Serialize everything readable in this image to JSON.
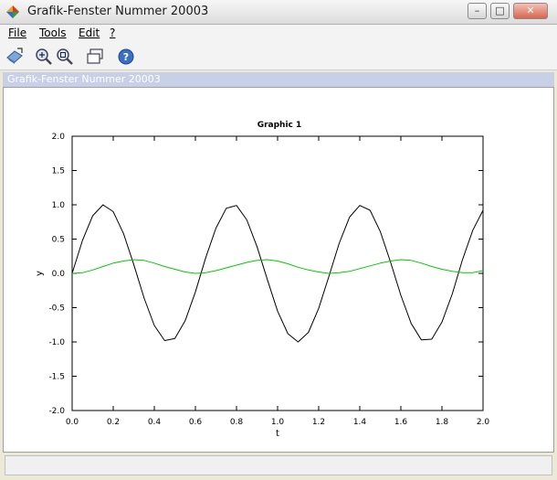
{
  "window": {
    "title": "Grafik-Fenster Nummer 20003",
    "controls": {
      "minimize": "–",
      "maximize": "□",
      "close": "✕"
    }
  },
  "menu": [
    {
      "label": "File"
    },
    {
      "label": "Tools"
    },
    {
      "label": "Edit"
    },
    {
      "label": "?"
    }
  ],
  "toolbar": {
    "icons": [
      "rotate-icon",
      "zoom-in-icon",
      "zoom-reset-icon",
      "window-icon",
      "help-icon"
    ]
  },
  "panel": {
    "title": "Grafik-Fenster Nummer 20003"
  },
  "status": {
    "text": ""
  },
  "chart_data": {
    "type": "line",
    "title": "Graphic 1",
    "xlabel": "t",
    "ylabel": "y",
    "xlim": [
      0,
      2
    ],
    "ylim": [
      -2,
      2
    ],
    "x_ticks": [
      "0.0",
      "0.2",
      "0.4",
      "0.6",
      "0.8",
      "1.0",
      "1.2",
      "1.4",
      "1.6",
      "1.8",
      "2.0"
    ],
    "y_ticks": [
      "-2.0",
      "-1.5",
      "-1.0",
      "-0.5",
      "0.0",
      "0.5",
      "1.0",
      "1.5",
      "2.0"
    ],
    "x_tick_values": [
      0,
      0.2,
      0.4,
      0.6,
      0.8,
      1.0,
      1.2,
      1.4,
      1.6,
      1.8,
      2.0
    ],
    "y_tick_values": [
      -2,
      -1.5,
      -1,
      -0.5,
      0,
      0.5,
      1,
      1.5,
      2
    ],
    "grid": false,
    "series": [
      {
        "color": "#000000",
        "x": [
          0,
          0.05,
          0.1,
          0.15,
          0.2,
          0.25,
          0.3,
          0.35,
          0.4,
          0.45,
          0.5,
          0.55,
          0.6,
          0.65,
          0.7,
          0.75,
          0.8,
          0.85,
          0.9,
          0.95,
          1.0,
          1.05,
          1.1,
          1.15,
          1.2,
          1.25,
          1.3,
          1.35,
          1.4,
          1.45,
          1.5,
          1.55,
          1.6,
          1.65,
          1.7,
          1.75,
          1.8,
          1.85,
          1.9,
          1.95,
          2.0
        ],
        "values": [
          0,
          0.48,
          0.84,
          1,
          0.9,
          0.58,
          0.13,
          -0.36,
          -0.76,
          -0.98,
          -0.95,
          -0.69,
          -0.27,
          0.23,
          0.66,
          0.95,
          0.99,
          0.78,
          0.39,
          -0.09,
          -0.55,
          -0.88,
          -1,
          -0.86,
          -0.51,
          -0.04,
          0.44,
          0.82,
          0.99,
          0.92,
          0.61,
          0.16,
          -0.32,
          -0.73,
          -0.97,
          -0.96,
          -0.71,
          -0.3,
          0.2,
          0.63,
          0.92
        ]
      },
      {
        "color": "#00cc00",
        "x": [
          0,
          0.05,
          0.1,
          0.15,
          0.2,
          0.25,
          0.3,
          0.35,
          0.4,
          0.45,
          0.5,
          0.55,
          0.6,
          0.65,
          0.7,
          0.75,
          0.8,
          0.85,
          0.9,
          0.95,
          1.0,
          1.05,
          1.1,
          1.15,
          1.2,
          1.25,
          1.3,
          1.35,
          1.4,
          1.45,
          1.5,
          1.55,
          1.6,
          1.65,
          1.7,
          1.75,
          1.8,
          1.85,
          1.9,
          1.95,
          2.0
        ],
        "values": [
          0,
          0.01,
          0.05,
          0.1,
          0.15,
          0.18,
          0.2,
          0.19,
          0.15,
          0.1,
          0.06,
          0.02,
          0,
          0.01,
          0.04,
          0.08,
          0.12,
          0.16,
          0.19,
          0.2,
          0.18,
          0.14,
          0.09,
          0.05,
          0.02,
          0,
          0.01,
          0.03,
          0.07,
          0.11,
          0.15,
          0.18,
          0.2,
          0.19,
          0.15,
          0.1,
          0.06,
          0.03,
          0.01,
          0.01,
          0.04
        ]
      }
    ]
  }
}
